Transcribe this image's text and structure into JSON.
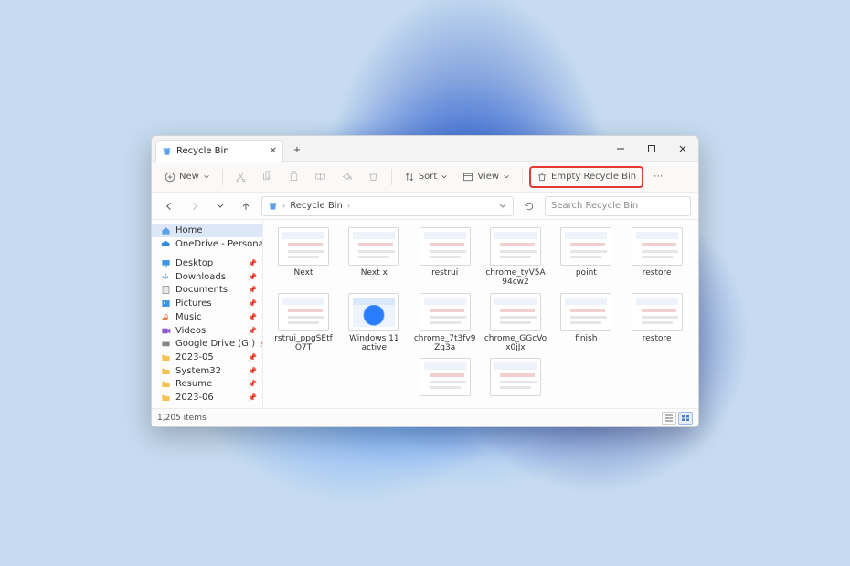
{
  "window": {
    "tab_title": "Recycle Bin",
    "add_tab": "+"
  },
  "toolbar": {
    "new_label": "New",
    "sort_label": "Sort",
    "view_label": "View",
    "empty_label": "Empty Recycle Bin",
    "more": "⋯"
  },
  "address": {
    "location": "Recycle Bin",
    "search_placeholder": "Search Recycle Bin"
  },
  "sidebar": {
    "items": [
      {
        "label": "Home"
      },
      {
        "label": "OneDrive - Personal"
      },
      {
        "label": ""
      },
      {
        "label": "Desktop"
      },
      {
        "label": "Downloads"
      },
      {
        "label": "Documents"
      },
      {
        "label": "Pictures"
      },
      {
        "label": "Music"
      },
      {
        "label": "Videos"
      },
      {
        "label": "Google Drive (G:)"
      },
      {
        "label": "2023-05"
      },
      {
        "label": "System32"
      },
      {
        "label": "Resume"
      },
      {
        "label": "2023-06"
      }
    ]
  },
  "files": {
    "row1": [
      {
        "name": "Next"
      },
      {
        "name": "Next x"
      },
      {
        "name": "restrui"
      },
      {
        "name": "chrome_tyV5A94cw2"
      },
      {
        "name": "point"
      },
      {
        "name": "restore"
      }
    ],
    "row2": [
      {
        "name": "rstrui_ppgSEtfO7T"
      },
      {
        "name": "Windows 11 active"
      },
      {
        "name": "chrome_7t3fv9Zq3a"
      },
      {
        "name": "chrome_GGcVox0jJx"
      },
      {
        "name": "finish"
      },
      {
        "name": "restore"
      }
    ]
  },
  "status": {
    "count": "1,205 items"
  }
}
